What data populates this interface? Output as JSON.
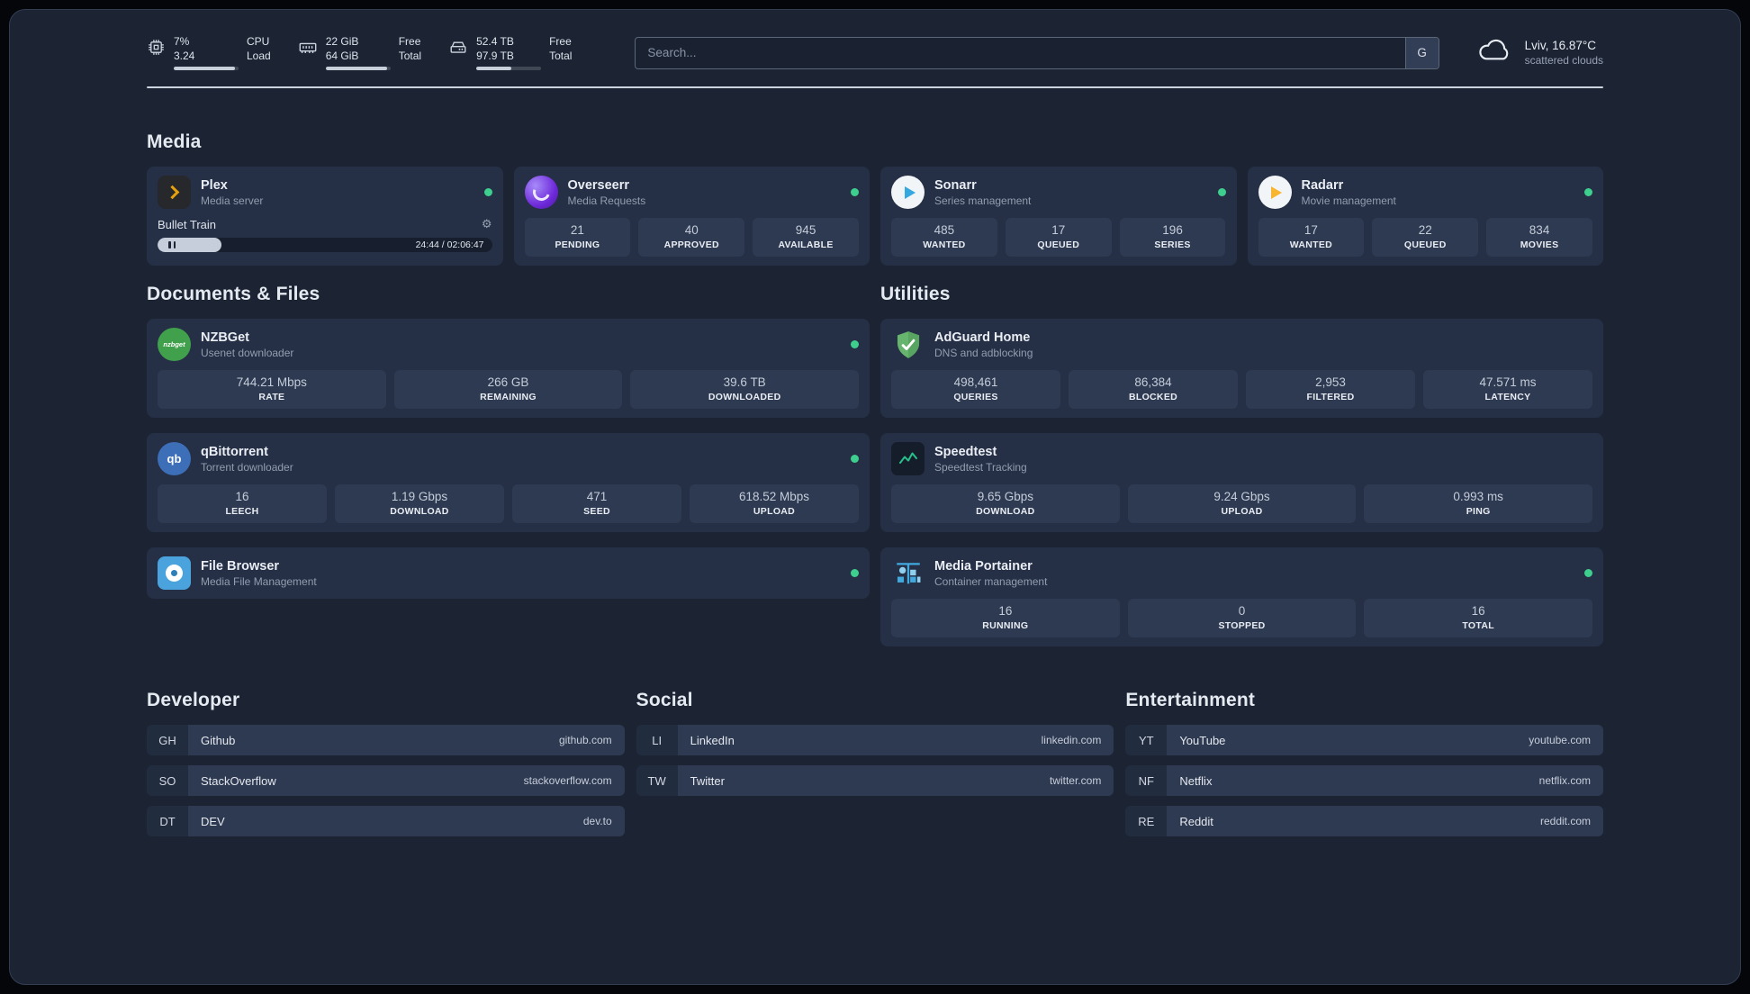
{
  "topbar": {
    "cpu": {
      "value1": "7%",
      "value2": "3.24",
      "label1": "CPU",
      "label2": "Load",
      "progress": 95
    },
    "memory": {
      "value1": "22 GiB",
      "value2": "64 GiB",
      "label1": "Free",
      "label2": "Total",
      "progress": 95
    },
    "disk": {
      "value1": "52.4 TB",
      "value2": "97.9 TB",
      "label1": "Free",
      "label2": "Total",
      "progress": 54
    },
    "search": {
      "placeholder": "Search...",
      "button_label": "G"
    },
    "weather": {
      "location": "Lviv, 16.87°C",
      "condition": "scattered clouds"
    }
  },
  "headings": {
    "media": "Media",
    "documents": "Documents & Files",
    "utilities": "Utilities",
    "developer": "Developer",
    "social": "Social",
    "entertainment": "Entertainment"
  },
  "icons": {
    "gear": "⚙"
  },
  "services": {
    "plex": {
      "name": "Plex",
      "desc": "Media server",
      "now_playing": "Bullet Train",
      "elapsed": "24:44 / 02:06:47",
      "progress": 19
    },
    "overseerr": {
      "name": "Overseerr",
      "desc": "Media Requests",
      "stats": [
        {
          "value": "21",
          "label": "PENDING"
        },
        {
          "value": "40",
          "label": "APPROVED"
        },
        {
          "value": "945",
          "label": "AVAILABLE"
        }
      ]
    },
    "sonarr": {
      "name": "Sonarr",
      "desc": "Series management",
      "stats": [
        {
          "value": "485",
          "label": "WANTED"
        },
        {
          "value": "17",
          "label": "QUEUED"
        },
        {
          "value": "196",
          "label": "SERIES"
        }
      ]
    },
    "radarr": {
      "name": "Radarr",
      "desc": "Movie management",
      "stats": [
        {
          "value": "17",
          "label": "WANTED"
        },
        {
          "value": "22",
          "label": "QUEUED"
        },
        {
          "value": "834",
          "label": "MOVIES"
        }
      ]
    },
    "nzbget": {
      "name": "NZBGet",
      "desc": "Usenet downloader",
      "icon_text": "nzbget",
      "stats": [
        {
          "value": "744.21 Mbps",
          "label": "RATE"
        },
        {
          "value": "266 GB",
          "label": "REMAINING"
        },
        {
          "value": "39.6 TB",
          "label": "DOWNLOADED"
        }
      ]
    },
    "qbittorrent": {
      "name": "qBittorrent",
      "desc": "Torrent downloader",
      "icon_text": "qb",
      "stats": [
        {
          "value": "16",
          "label": "LEECH"
        },
        {
          "value": "1.19 Gbps",
          "label": "DOWNLOAD"
        },
        {
          "value": "471",
          "label": "SEED"
        },
        {
          "value": "618.52 Mbps",
          "label": "UPLOAD"
        }
      ]
    },
    "filebrowser": {
      "name": "File Browser",
      "desc": "Media File Management"
    },
    "adguard": {
      "name": "AdGuard Home",
      "desc": "DNS and adblocking",
      "stats": [
        {
          "value": "498,461",
          "label": "QUERIES"
        },
        {
          "value": "86,384",
          "label": "BLOCKED"
        },
        {
          "value": "2,953",
          "label": "FILTERED"
        },
        {
          "value": "47.571 ms",
          "label": "LATENCY"
        }
      ]
    },
    "speedtest": {
      "name": "Speedtest",
      "desc": "Speedtest Tracking",
      "stats": [
        {
          "value": "9.65 Gbps",
          "label": "DOWNLOAD"
        },
        {
          "value": "9.24 Gbps",
          "label": "UPLOAD"
        },
        {
          "value": "0.993 ms",
          "label": "PING"
        }
      ]
    },
    "portainer": {
      "name": "Media Portainer",
      "desc": "Container management",
      "stats": [
        {
          "value": "16",
          "label": "RUNNING"
        },
        {
          "value": "0",
          "label": "STOPPED"
        },
        {
          "value": "16",
          "label": "TOTAL"
        }
      ]
    }
  },
  "bookmarks": {
    "developer": [
      {
        "abbr": "GH",
        "name": "Github",
        "url": "github.com"
      },
      {
        "abbr": "SO",
        "name": "StackOverflow",
        "url": "stackoverflow.com"
      },
      {
        "abbr": "DT",
        "name": "DEV",
        "url": "dev.to"
      }
    ],
    "social": [
      {
        "abbr": "LI",
        "name": "LinkedIn",
        "url": "linkedin.com"
      },
      {
        "abbr": "TW",
        "name": "Twitter",
        "url": "twitter.com"
      }
    ],
    "entertainment": [
      {
        "abbr": "YT",
        "name": "YouTube",
        "url": "youtube.com"
      },
      {
        "abbr": "NF",
        "name": "Netflix",
        "url": "netflix.com"
      },
      {
        "abbr": "RE",
        "name": "Reddit",
        "url": "reddit.com"
      }
    ]
  },
  "colors": {
    "status_online": "#3ecf8e",
    "accent_plex": "#e5a00d"
  }
}
